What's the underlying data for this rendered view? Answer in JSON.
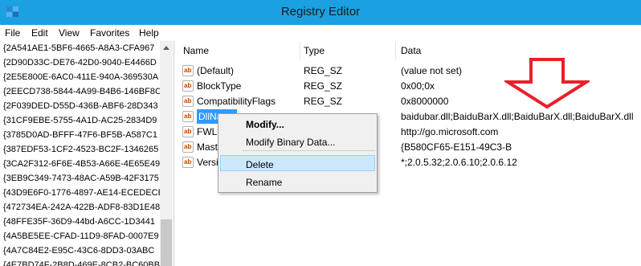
{
  "window": {
    "title": "Registry Editor"
  },
  "menu": [
    "File",
    "Edit",
    "View",
    "Favorites",
    "Help"
  ],
  "tree": {
    "items": [
      "{2A541AE1-5BF6-4665-A8A3-CFA967",
      "{2D90D33C-DE76-42D0-9040-E4466D",
      "{2E5E800E-6AC0-411E-940A-369530A",
      "{2EECD738-5844-4A99-B4B6-146BF8C",
      "{2F039DED-D55D-436B-ABF6-28D343",
      "{31CF9EBE-5755-4A1D-AC25-2834D9",
      "{3785D0AD-BFFF-47F6-BF5B-A587C1",
      "{387EDF53-1CF2-4523-BC2F-1346265",
      "{3CA2F312-6F6E-4B53-A66E-4E65E49",
      "{3EB9C349-7473-48AC-A59B-42F3175",
      "{43D9E6F0-1776-4897-AE14-ECEDECE",
      "{472734EA-242A-422B-ADF8-83D1E48",
      "{48FFE35F-36D9-44bd-A6CC-1D3441",
      "{4A5BE5EE-CFAD-11D9-8FAD-0007E9",
      "{4A7C84E2-E95C-43C6-8DD3-03ABC",
      "{4E7BD74F-2B8D-469E-8CB2-BC60BB"
    ]
  },
  "columns": {
    "name": "Name",
    "type": "Type",
    "data": "Data"
  },
  "values": [
    {
      "name": "(Default)",
      "type": "REG_SZ",
      "data": "(value not set)"
    },
    {
      "name": "BlockType",
      "type": "REG_SZ",
      "data": "0x00;0x"
    },
    {
      "name": "CompatibilityFlags",
      "type": "REG_SZ",
      "data": "0x8000000"
    },
    {
      "name": "DllNa",
      "type": "",
      "data": "baidubar.dll;BaiduBarX.dll;BaiduBarX.dll;BaiduBarX.dll"
    },
    {
      "name": "FWLi",
      "type": "",
      "data": "http://go.microsoft.com"
    },
    {
      "name": "Mast",
      "type": "",
      "data": "{B580CF65-E151-49C3-B"
    },
    {
      "name": "Versi",
      "type": "",
      "data": "*;2.0.5.32;2.0.6.10;2.0.6.12"
    }
  ],
  "context_menu": {
    "modify": "Modify...",
    "modify_binary": "Modify Binary Data...",
    "delete": "Delete",
    "rename": "Rename"
  },
  "annotation": {
    "arrow_color": "#e8202a"
  },
  "colors": {
    "titlebar": "#1ba1e2",
    "selection": "#3399ff"
  }
}
